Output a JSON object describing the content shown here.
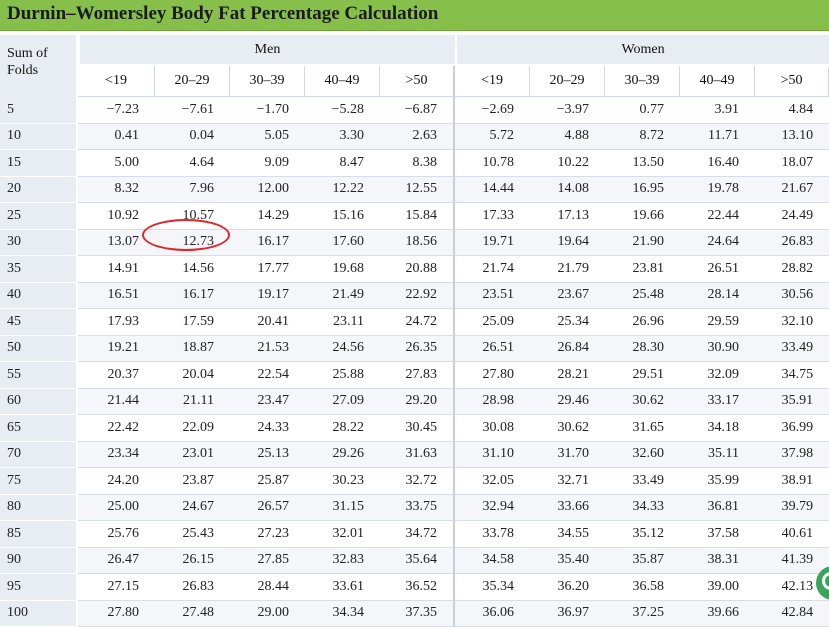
{
  "title": "Durnin–Womersley Body Fat Percentage Calculation",
  "header": {
    "sum_of_folds_line1": "Sum of",
    "sum_of_folds_line2": "Folds",
    "men": "Men",
    "women": "Women",
    "men_ages": [
      "<19",
      "20–29",
      "30–39",
      "40–49",
      ">50"
    ],
    "women_ages": [
      "<19",
      "20–29",
      "30–39",
      "40–49",
      ">50"
    ]
  },
  "rows": [
    {
      "folds": "5",
      "men": [
        "−7.23",
        "−7.61",
        "−1.70",
        "−5.28",
        "−6.87"
      ],
      "women": [
        "−2.69",
        "−3.97",
        "0.77",
        "3.91",
        "4.84"
      ]
    },
    {
      "folds": "10",
      "men": [
        "0.41",
        "0.04",
        "5.05",
        "3.30",
        "2.63"
      ],
      "women": [
        "5.72",
        "4.88",
        "8.72",
        "11.71",
        "13.10"
      ]
    },
    {
      "folds": "15",
      "men": [
        "5.00",
        "4.64",
        "9.09",
        "8.47",
        "8.38"
      ],
      "women": [
        "10.78",
        "10.22",
        "13.50",
        "16.40",
        "18.07"
      ]
    },
    {
      "folds": "20",
      "men": [
        "8.32",
        "7.96",
        "12.00",
        "12.22",
        "12.55"
      ],
      "women": [
        "14.44",
        "14.08",
        "16.95",
        "19.78",
        "21.67"
      ]
    },
    {
      "folds": "25",
      "men": [
        "10.92",
        "10.57",
        "14.29",
        "15.16",
        "15.84"
      ],
      "women": [
        "17.33",
        "17.13",
        "19.66",
        "22.44",
        "24.49"
      ]
    },
    {
      "folds": "30",
      "men": [
        "13.07",
        "12.73",
        "16.17",
        "17.60",
        "18.56"
      ],
      "women": [
        "19.71",
        "19.64",
        "21.90",
        "24.64",
        "26.83"
      ]
    },
    {
      "folds": "35",
      "men": [
        "14.91",
        "14.56",
        "17.77",
        "19.68",
        "20.88"
      ],
      "women": [
        "21.74",
        "21.79",
        "23.81",
        "26.51",
        "28.82"
      ]
    },
    {
      "folds": "40",
      "men": [
        "16.51",
        "16.17",
        "19.17",
        "21.49",
        "22.92"
      ],
      "women": [
        "23.51",
        "23.67",
        "25.48",
        "28.14",
        "30.56"
      ]
    },
    {
      "folds": "45",
      "men": [
        "17.93",
        "17.59",
        "20.41",
        "23.11",
        "24.72"
      ],
      "women": [
        "25.09",
        "25.34",
        "26.96",
        "29.59",
        "32.10"
      ]
    },
    {
      "folds": "50",
      "men": [
        "19.21",
        "18.87",
        "21.53",
        "24.56",
        "26.35"
      ],
      "women": [
        "26.51",
        "26.84",
        "28.30",
        "30.90",
        "33.49"
      ]
    },
    {
      "folds": "55",
      "men": [
        "20.37",
        "20.04",
        "22.54",
        "25.88",
        "27.83"
      ],
      "women": [
        "27.80",
        "28.21",
        "29.51",
        "32.09",
        "34.75"
      ]
    },
    {
      "folds": "60",
      "men": [
        "21.44",
        "21.11",
        "23.47",
        "27.09",
        "29.20"
      ],
      "women": [
        "28.98",
        "29.46",
        "30.62",
        "33.17",
        "35.91"
      ]
    },
    {
      "folds": "65",
      "men": [
        "22.42",
        "22.09",
        "24.33",
        "28.22",
        "30.45"
      ],
      "women": [
        "30.08",
        "30.62",
        "31.65",
        "34.18",
        "36.99"
      ]
    },
    {
      "folds": "70",
      "men": [
        "23.34",
        "23.01",
        "25.13",
        "29.26",
        "31.63"
      ],
      "women": [
        "31.10",
        "31.70",
        "32.60",
        "35.11",
        "37.98"
      ]
    },
    {
      "folds": "75",
      "men": [
        "24.20",
        "23.87",
        "25.87",
        "30.23",
        "32.72"
      ],
      "women": [
        "32.05",
        "32.71",
        "33.49",
        "35.99",
        "38.91"
      ]
    },
    {
      "folds": "80",
      "men": [
        "25.00",
        "24.67",
        "26.57",
        "31.15",
        "33.75"
      ],
      "women": [
        "32.94",
        "33.66",
        "34.33",
        "36.81",
        "39.79"
      ]
    },
    {
      "folds": "85",
      "men": [
        "25.76",
        "25.43",
        "27.23",
        "32.01",
        "34.72"
      ],
      "women": [
        "33.78",
        "34.55",
        "35.12",
        "37.58",
        "40.61"
      ]
    },
    {
      "folds": "90",
      "men": [
        "26.47",
        "26.15",
        "27.85",
        "32.83",
        "35.64"
      ],
      "women": [
        "34.58",
        "35.40",
        "35.87",
        "38.31",
        "41.39"
      ]
    },
    {
      "folds": "95",
      "men": [
        "27.15",
        "26.83",
        "28.44",
        "33.61",
        "36.52"
      ],
      "women": [
        "35.34",
        "36.20",
        "36.58",
        "39.00",
        "42.13"
      ]
    },
    {
      "folds": "100",
      "men": [
        "27.80",
        "27.48",
        "29.00",
        "34.34",
        "37.35"
      ],
      "women": [
        "36.06",
        "36.97",
        "37.25",
        "39.66",
        "42.84"
      ]
    }
  ],
  "colors": {
    "title_bar": "#86c04b",
    "header_bg": "#e8edf4",
    "highlight_circle": "#e0262a",
    "corner_badge": "#3aa55a"
  },
  "icons": {
    "corner_badge": "circle-badge-icon"
  }
}
